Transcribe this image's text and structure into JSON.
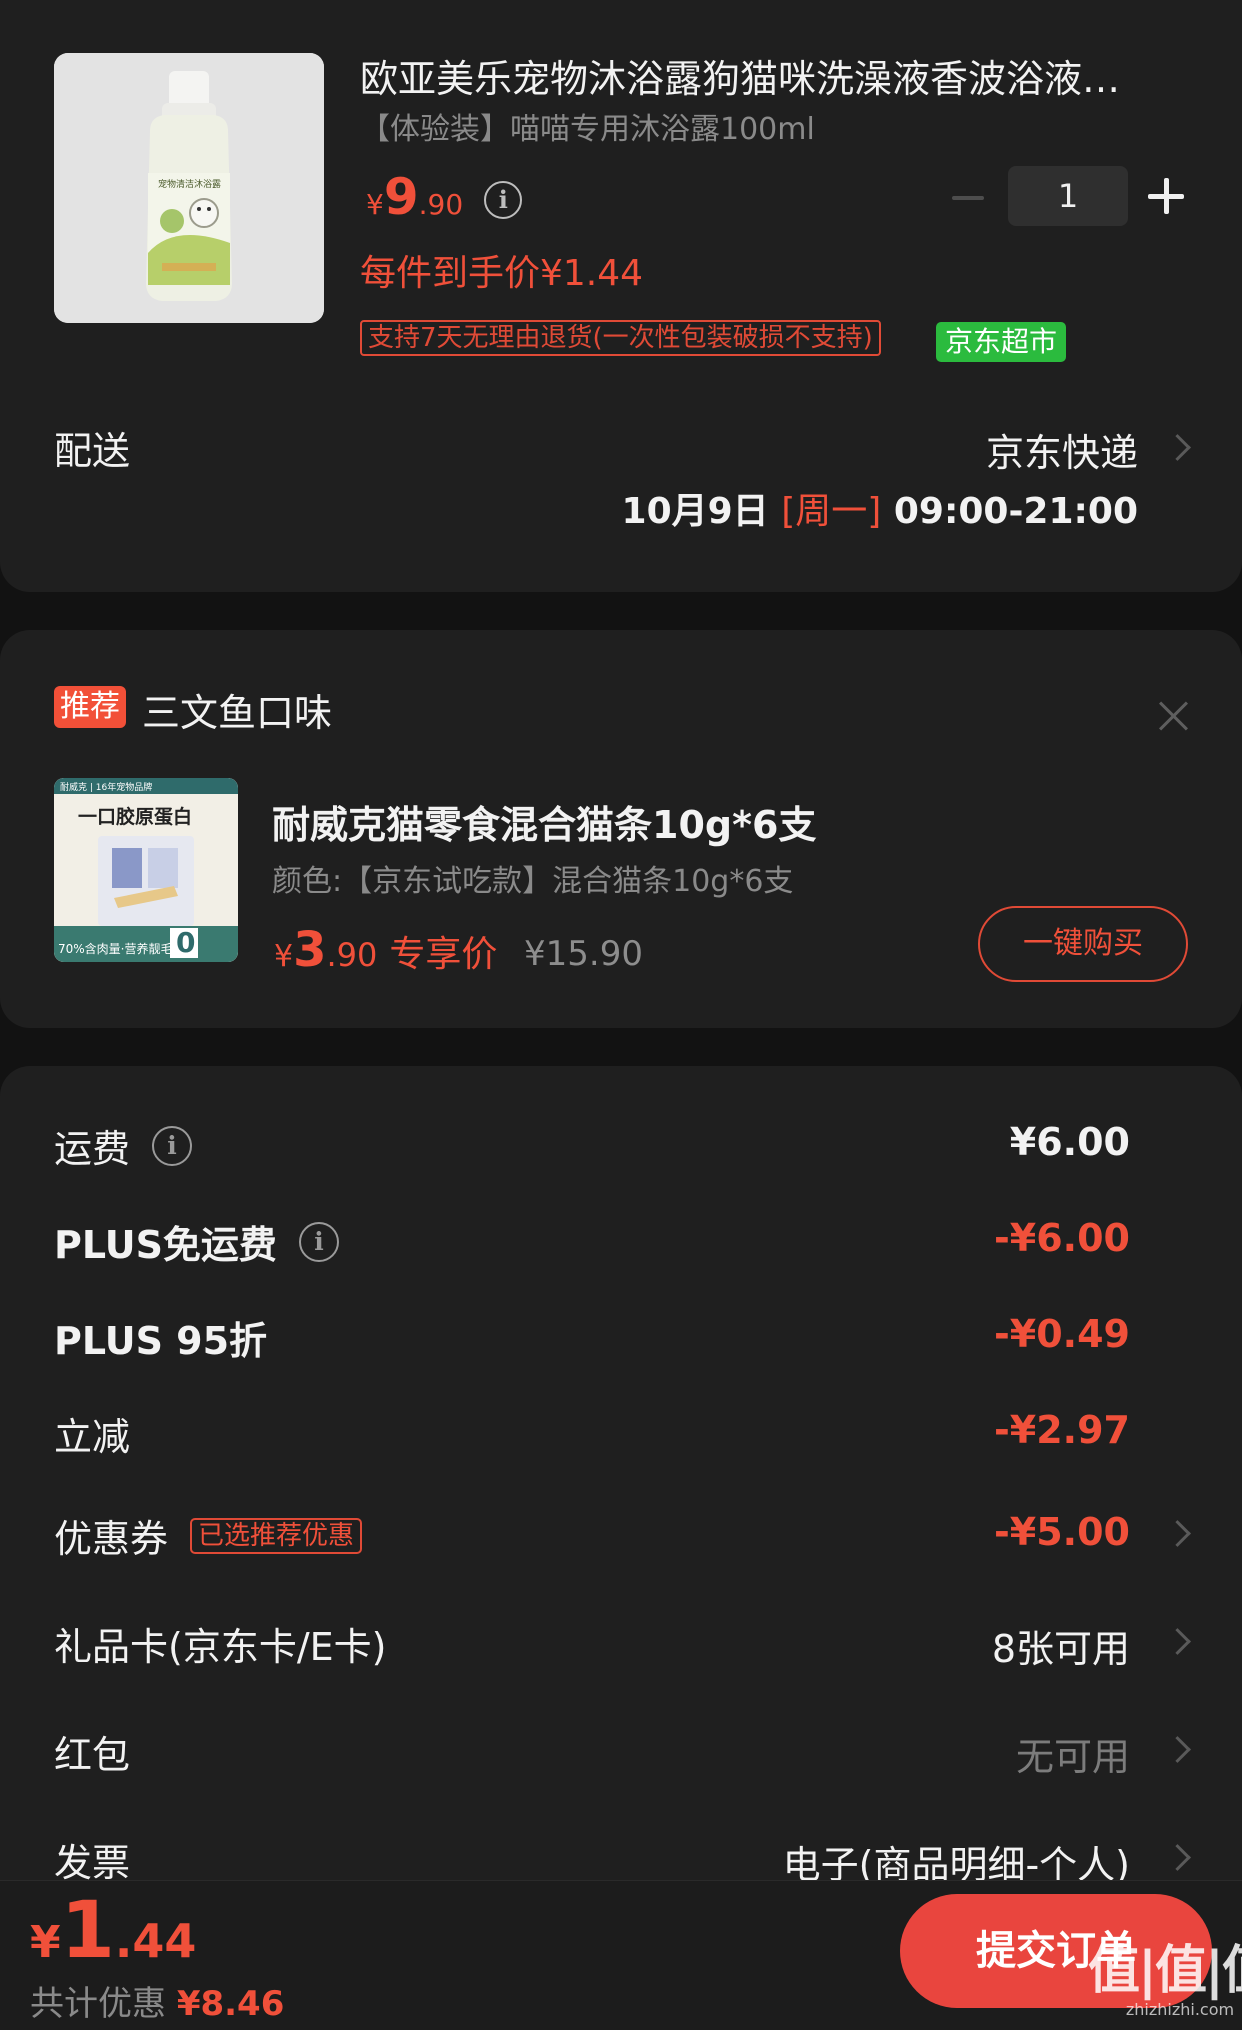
{
  "colors": {
    "accent": "#f0503a",
    "background": "#121212",
    "card": "#1f1f1f",
    "market_green": "#2bbb3e",
    "submit": "#e9453e"
  },
  "product": {
    "title": "欧亚美乐宠物沐浴露狗猫咪洗澡液香波浴液…",
    "spec": "【体验装】喵喵专用沐浴露100ml",
    "price_currency": "¥",
    "price_int": "9",
    "price_dec": ".90",
    "info_icon": "i",
    "each_price": "每件到手价¥1.44",
    "quantity": "1",
    "tag_return": "支持7天无理由退货(一次性包装破损不支持)",
    "tag_market": "京东超市",
    "image_label": "宠物清洁沐浴露"
  },
  "delivery": {
    "label": "配送",
    "method": "京东快递",
    "date": "10月9日",
    "weekday": "[周一]",
    "time": "09:00-21:00"
  },
  "recommend": {
    "badge": "推荐",
    "title": "三文鱼口味",
    "name": "耐威克猫零食混合猫条10g*6支",
    "spec": "颜色:【京东试吃款】混合猫条10g*6支",
    "price_currency": "¥",
    "price_int": "3",
    "price_dec": ".90",
    "price_label": "专享价",
    "original_price": "¥15.90",
    "buy_button": "一键购买",
    "image_top_text": "耐威克 | 16年宠物品牌",
    "image_headline": "一口胶原蛋白",
    "image_bottom_text": "70%含肉量·营养靓毛",
    "image_zero": "0"
  },
  "fees": [
    {
      "label": "运费",
      "value": "¥6.00",
      "style": "neutral",
      "info": true,
      "chevron": false
    },
    {
      "label": "PLUS免运费",
      "value": "-¥6.00",
      "style": "red",
      "info": true,
      "chevron": false
    },
    {
      "label": "PLUS 95折",
      "value": "-¥0.49",
      "style": "red",
      "info": false,
      "chevron": false
    },
    {
      "label": "立减",
      "value": "-¥2.97",
      "style": "red",
      "info": false,
      "chevron": false
    },
    {
      "label": "优惠券",
      "value": "-¥5.00",
      "style": "red",
      "info": false,
      "chevron": true,
      "tag": "已选推荐优惠"
    },
    {
      "label": "礼品卡(京东卡/E卡)",
      "value": "8张可用",
      "style": "plain",
      "info": false,
      "chevron": true
    },
    {
      "label": "红包",
      "value": "无可用",
      "style": "gray",
      "info": false,
      "chevron": true
    },
    {
      "label": "发票",
      "value": "电子(商品明细-个人)",
      "style": "plain",
      "info": false,
      "chevron": true
    }
  ],
  "footer": {
    "total_currency": "¥",
    "total_int": "1",
    "total_dec": ".44",
    "discount_label": "共计优惠",
    "discount_amount": "¥8.46",
    "submit_button": "提交订单",
    "watermark_big": "值|值|值",
    "watermark_small": "zhizhizhi.com"
  }
}
